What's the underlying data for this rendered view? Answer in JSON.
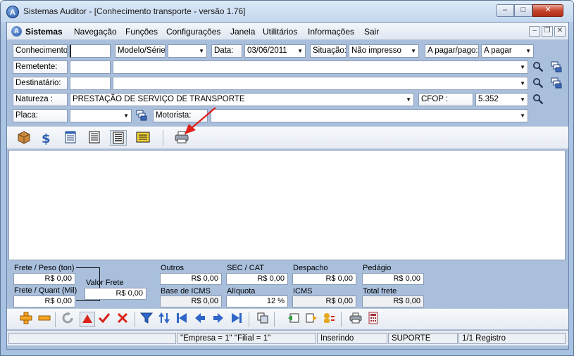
{
  "window": {
    "title": "Sistemas Auditor - [Conhecimento transporte - versão 1.76]",
    "app_icon": "A",
    "min_label": "–",
    "max_label": "□",
    "close_label": "✕"
  },
  "menu": {
    "logo": "A",
    "items": [
      "Sistemas",
      "Navegação",
      "Funções",
      "Configurações",
      "Janela",
      "Utilitários",
      "Informações",
      "Sair"
    ],
    "mdi_min": "–",
    "mdi_restore": "❐",
    "mdi_close": "✕"
  },
  "form": {
    "conhecimento_label": "Conhecimento:",
    "conhecimento_value": "",
    "modelo_label": "Modelo/Série:",
    "modelo_value": "",
    "data_label": "Data:",
    "data_value": "03/06/2011",
    "situacao_label": "Situação:",
    "situacao_value": "Não impresso",
    "apagar_label": "A pagar/pago:",
    "apagar_value": "A pagar",
    "remetente_label": "Remetente:",
    "remetente_code": "",
    "remetente_name": "",
    "destinatario_label": "Destinatário:",
    "destinatario_code": "",
    "destinatario_name": "",
    "natureza_label": "Natureza :",
    "natureza_value": "PRESTAÇÃO DE SERVIÇO DE TRANSPORTE",
    "cfop_label": "CFOP :",
    "cfop_value": "5.352",
    "placa_label": "Placa:",
    "placa_value": "",
    "motorista_label": "Motorista:",
    "motorista_code": "",
    "motorista_name": ""
  },
  "icons": {
    "search": "search-icon",
    "list": "list-icon"
  },
  "totals": {
    "frete_peso_label": "Frete / Peso (ton)",
    "frete_peso_value": "R$ 0,00",
    "frete_quant_label": "Frete / Quant (Mil)",
    "frete_quant_value": "R$ 0,00",
    "valor_frete_label": "Valor Frete",
    "valor_frete_value": "R$ 0,00",
    "outros_label": "Outros",
    "outros_value": "R$ 0,00",
    "sec_cat_label": "SEC / CAT",
    "sec_cat_value": "R$ 0,00",
    "despacho_label": "Despacho",
    "despacho_value": "R$ 0,00",
    "pedagio_label": "Pedágio",
    "pedagio_value": "R$ 0,00",
    "base_icms_label": "Base de ICMS",
    "base_icms_value": "R$ 0,00",
    "aliquota_label": "Alíquota",
    "aliquota_value": "12 %",
    "icms_label": "ICMS",
    "icms_value": "R$ 0,00",
    "total_frete_label": "Total frete",
    "total_frete_value": "R$ 0,00"
  },
  "status": {
    "blank1": "",
    "blank2": "",
    "empresa_filial": "\"Empresa = 1\"   \"Filial = 1\"",
    "mode": "Inserindo",
    "user": "SUPORTE",
    "records": "1/1 Registro"
  },
  "colors": {
    "annotation_arrow": "#e0201b"
  }
}
